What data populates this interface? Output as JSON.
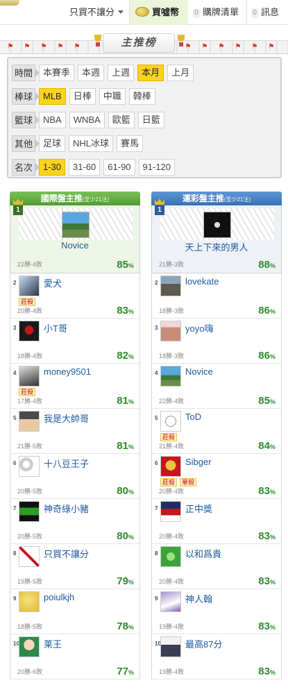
{
  "topbar": {
    "dropdown_label": "只買不讓分",
    "coins_label": "買噓幣",
    "cart_count": "0",
    "cart_label": "購牌清單",
    "msg_count": "0",
    "msg_label": "訊息"
  },
  "banner": {
    "title": "主推榜"
  },
  "filters": {
    "period": {
      "label": "時間",
      "options": [
        "本賽季",
        "本週",
        "上週",
        "本月",
        "上月"
      ],
      "active": "本月"
    },
    "baseball": {
      "label": "棒球",
      "options": [
        "MLB",
        "日棒",
        "中職",
        "韓棒"
      ],
      "active": "MLB"
    },
    "basketball": {
      "label": "籃球",
      "options": [
        "NBA",
        "WNBA",
        "歐籃",
        "日籃"
      ],
      "active": ""
    },
    "other": {
      "label": "其他",
      "options": [
        "足球",
        "NHL冰球",
        "賽馬"
      ],
      "active": ""
    },
    "rank": {
      "label": "名次",
      "options": [
        "1-30",
        "31-60",
        "61-90",
        "91-120"
      ],
      "active": "1-30"
    }
  },
  "left_column": {
    "title": "國際盤主推",
    "subtitle": "(至少21注)",
    "pct_suffix": "%",
    "entries": [
      {
        "rank": "1",
        "name": "Novice",
        "record": "22勝-4敗",
        "pct": "85",
        "tags": []
      },
      {
        "rank": "2",
        "name": "愛犬",
        "record": "20勝-4敗",
        "pct": "83",
        "tags": [
          "莊殺"
        ]
      },
      {
        "rank": "3",
        "name": "小T哥",
        "record": "18勝-4敗",
        "pct": "82",
        "tags": []
      },
      {
        "rank": "4",
        "name": "money9501",
        "record": "17勝-4敗",
        "pct": "81",
        "tags": [
          "莊殺"
        ]
      },
      {
        "rank": "5",
        "name": "我是大帥哥",
        "record": "21勝-5敗",
        "pct": "81",
        "tags": []
      },
      {
        "rank": "6",
        "name": "十八豆王子",
        "record": "20勝-5敗",
        "pct": "80",
        "tags": []
      },
      {
        "rank": "7",
        "name": "神奇綠小豬",
        "record": "20勝-5敗",
        "pct": "80",
        "tags": []
      },
      {
        "rank": "8",
        "name": "只買不讓分",
        "record": "19勝-5敗",
        "pct": "79",
        "tags": []
      },
      {
        "rank": "9",
        "name": "poiulkjh",
        "record": "18勝-5敗",
        "pct": "78",
        "tags": []
      },
      {
        "rank": "10",
        "name": "莱王",
        "record": "20勝-6敗",
        "pct": "77",
        "tags": []
      }
    ]
  },
  "right_column": {
    "title": "運彩盤主推",
    "subtitle": "(至少21注)",
    "pct_suffix": "%",
    "entries": [
      {
        "rank": "1",
        "name": "天上下來的男人",
        "record": "21勝-3敗",
        "pct": "88",
        "tags": []
      },
      {
        "rank": "2",
        "name": "lovekate",
        "record": "18勝-3敗",
        "pct": "86",
        "tags": []
      },
      {
        "rank": "3",
        "name": "yoyo嗨",
        "record": "18勝-3敗",
        "pct": "86",
        "tags": []
      },
      {
        "rank": "4",
        "name": "Novice",
        "record": "22勝-4敗",
        "pct": "85",
        "tags": []
      },
      {
        "rank": "5",
        "name": "ToD",
        "record": "21勝-4敗",
        "pct": "84",
        "tags": [
          "莊殺"
        ]
      },
      {
        "rank": "6",
        "name": "Sibger",
        "record": "20勝-4敗",
        "pct": "83",
        "tags": [
          "莊殺",
          "單殺"
        ]
      },
      {
        "rank": "7",
        "name": "正中獎",
        "record": "20勝-4敗",
        "pct": "83",
        "tags": []
      },
      {
        "rank": "8",
        "name": "以和爲貴",
        "record": "20勝-4敗",
        "pct": "83",
        "tags": []
      },
      {
        "rank": "9",
        "name": "神人翰",
        "record": "19勝-4敗",
        "pct": "83",
        "tags": []
      },
      {
        "rank": "10",
        "name": "最高87分",
        "record": "19勝-4敗",
        "pct": "83",
        "tags": []
      }
    ]
  },
  "colors": {
    "accent_yellow": "#ffd21c",
    "green_header": "#4f9c33",
    "blue_header": "#3870b4",
    "pct_green": "#2e8b2e",
    "name_blue": "#1b5aa0"
  }
}
